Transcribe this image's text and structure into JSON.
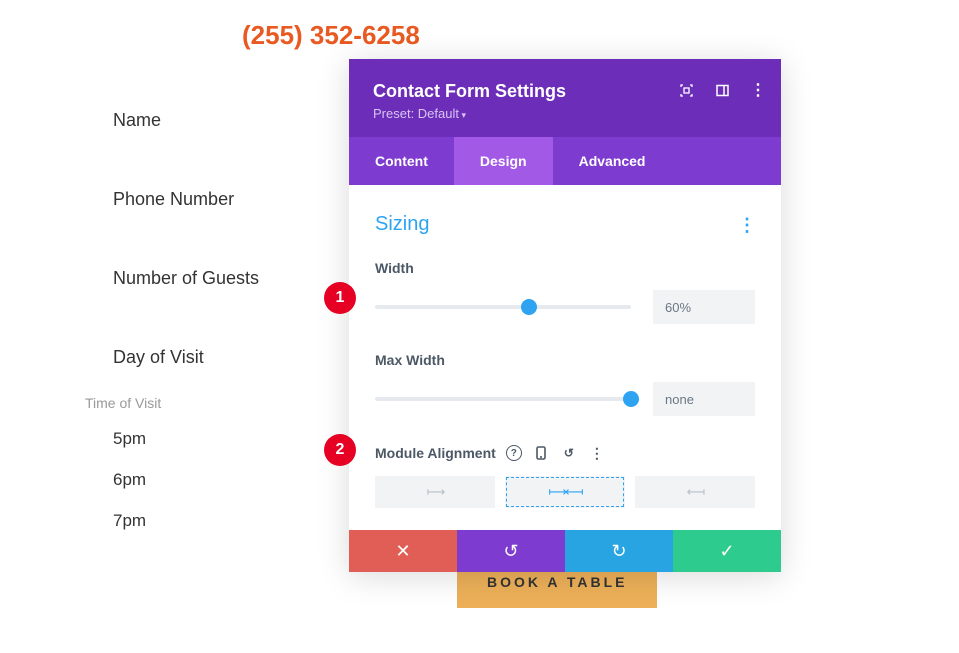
{
  "page": {
    "phone": "(255) 352-6258",
    "form_labels": [
      "Name",
      "Phone Number",
      "Number of Guests",
      "Day of Visit"
    ],
    "time_of_visit": {
      "title": "Time of Visit",
      "options": [
        "5pm",
        "6pm",
        "7pm"
      ]
    },
    "book_button": "BOOK A TABLE"
  },
  "modal": {
    "title": "Contact Form Settings",
    "preset": "Preset: Default",
    "tabs": {
      "content": "Content",
      "design": "Design",
      "advanced": "Advanced",
      "active": "Design"
    },
    "section": "Sizing",
    "width": {
      "label": "Width",
      "value": "60%",
      "percent": 60
    },
    "max_width": {
      "label": "Max Width",
      "value": "none",
      "percent": 100
    },
    "alignment": {
      "label": "Module Alignment",
      "selected": "center"
    }
  },
  "badges": {
    "one": "1",
    "two": "2"
  }
}
